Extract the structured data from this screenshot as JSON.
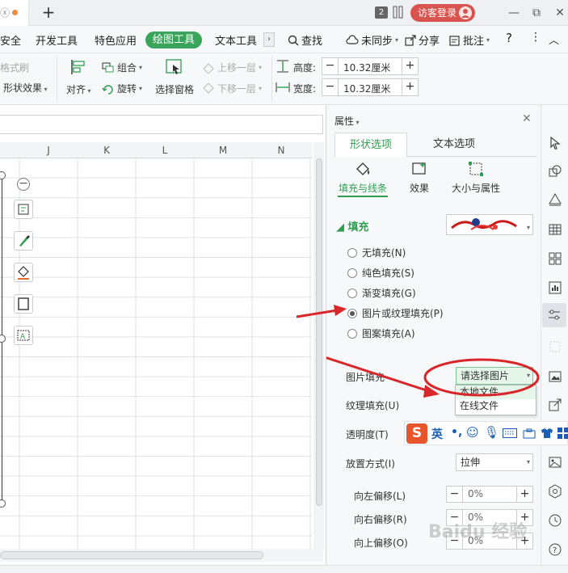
{
  "titlebar": {
    "window_count": "2",
    "login_label": "访客登录",
    "minimize": "—",
    "restore": "⧉",
    "close": "✕",
    "new_tab": "+"
  },
  "menu": {
    "tabs": [
      "安全",
      "开发工具",
      "特色应用",
      "绘图工具",
      "文本工具"
    ],
    "more": "›",
    "search": "查找",
    "sync": "未同步",
    "share": "分享",
    "annotate": "批注",
    "help": "?"
  },
  "ribbon": {
    "format_painter": "格式刷",
    "shape_effect": "形状效果",
    "align": "对齐",
    "group": "组合",
    "rotate": "旋转",
    "selection_pane": "选择窗格",
    "bring_forward": "上移一层",
    "send_backward": "下移一层",
    "height_label": "高度:",
    "height_value": "10.32厘米",
    "width_label": "宽度:",
    "width_value": "10.32厘米"
  },
  "sheet": {
    "columns": [
      "J",
      "K",
      "L",
      "M",
      "N"
    ]
  },
  "panel": {
    "title": "属性",
    "close": "✕",
    "tabs": [
      "形状选项",
      "文本选项"
    ],
    "subtabs": [
      "填充与线条",
      "效果",
      "大小与属性"
    ],
    "fill_section": "填充",
    "fill_options": [
      {
        "label": "无填充(N)",
        "selected": false
      },
      {
        "label": "纯色填充(S)",
        "selected": false
      },
      {
        "label": "渐变填充(G)",
        "selected": false
      },
      {
        "label": "图片或纹理填充(P)",
        "selected": true
      },
      {
        "label": "图案填充(A)",
        "selected": false
      }
    ],
    "picture_fill_label": "图片填充",
    "picture_fill_value": "请选择图片",
    "picture_fill_options": [
      "本地文件",
      "在线文件"
    ],
    "texture_fill_label": "纹理填充(U)",
    "transparency_label": "透明度(T)",
    "placement_label": "放置方式(I)",
    "placement_value": "拉伸",
    "offsets": [
      {
        "label": "向左偏移(L)",
        "value": "0%"
      },
      {
        "label": "向右偏移(R)",
        "value": "0%"
      },
      {
        "label": "向上偏移(O)",
        "value": "0%"
      }
    ]
  },
  "ime": {
    "lang": "英"
  },
  "watermark": "Baidu 经验",
  "colors": {
    "accent_green": "#2f9e50",
    "login_red": "#d9534f",
    "annotation_red": "#d9262a"
  },
  "icons": [
    "search-icon",
    "cloud-sync-icon",
    "share-icon",
    "annotate-icon",
    "cursor-icon",
    "shapes-icon",
    "table-icon",
    "chart-icon",
    "settings-sliders-icon",
    "image-icon",
    "share-out-icon",
    "help-icon"
  ]
}
